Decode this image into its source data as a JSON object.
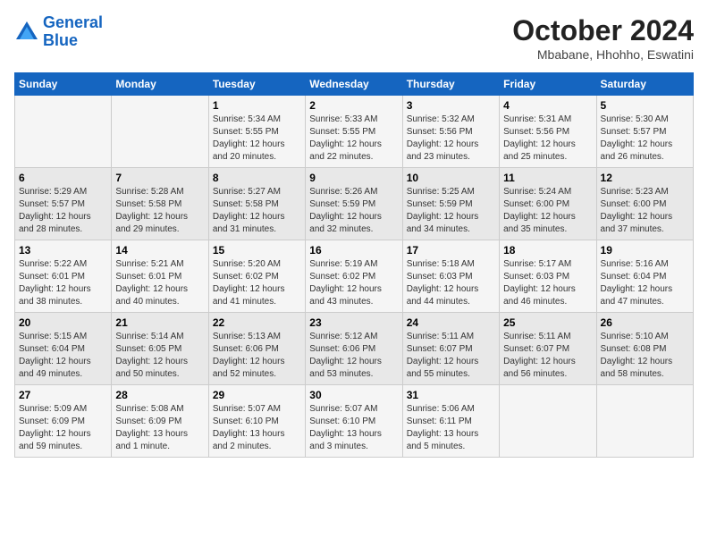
{
  "header": {
    "logo_line1": "General",
    "logo_line2": "Blue",
    "month_title": "October 2024",
    "subtitle": "Mbabane, Hhohho, Eswatini"
  },
  "weekdays": [
    "Sunday",
    "Monday",
    "Tuesday",
    "Wednesday",
    "Thursday",
    "Friday",
    "Saturday"
  ],
  "weeks": [
    [
      {
        "day": "",
        "content": ""
      },
      {
        "day": "",
        "content": ""
      },
      {
        "day": "1",
        "content": "Sunrise: 5:34 AM\nSunset: 5:55 PM\nDaylight: 12 hours\nand 20 minutes."
      },
      {
        "day": "2",
        "content": "Sunrise: 5:33 AM\nSunset: 5:55 PM\nDaylight: 12 hours\nand 22 minutes."
      },
      {
        "day": "3",
        "content": "Sunrise: 5:32 AM\nSunset: 5:56 PM\nDaylight: 12 hours\nand 23 minutes."
      },
      {
        "day": "4",
        "content": "Sunrise: 5:31 AM\nSunset: 5:56 PM\nDaylight: 12 hours\nand 25 minutes."
      },
      {
        "day": "5",
        "content": "Sunrise: 5:30 AM\nSunset: 5:57 PM\nDaylight: 12 hours\nand 26 minutes."
      }
    ],
    [
      {
        "day": "6",
        "content": "Sunrise: 5:29 AM\nSunset: 5:57 PM\nDaylight: 12 hours\nand 28 minutes."
      },
      {
        "day": "7",
        "content": "Sunrise: 5:28 AM\nSunset: 5:58 PM\nDaylight: 12 hours\nand 29 minutes."
      },
      {
        "day": "8",
        "content": "Sunrise: 5:27 AM\nSunset: 5:58 PM\nDaylight: 12 hours\nand 31 minutes."
      },
      {
        "day": "9",
        "content": "Sunrise: 5:26 AM\nSunset: 5:59 PM\nDaylight: 12 hours\nand 32 minutes."
      },
      {
        "day": "10",
        "content": "Sunrise: 5:25 AM\nSunset: 5:59 PM\nDaylight: 12 hours\nand 34 minutes."
      },
      {
        "day": "11",
        "content": "Sunrise: 5:24 AM\nSunset: 6:00 PM\nDaylight: 12 hours\nand 35 minutes."
      },
      {
        "day": "12",
        "content": "Sunrise: 5:23 AM\nSunset: 6:00 PM\nDaylight: 12 hours\nand 37 minutes."
      }
    ],
    [
      {
        "day": "13",
        "content": "Sunrise: 5:22 AM\nSunset: 6:01 PM\nDaylight: 12 hours\nand 38 minutes."
      },
      {
        "day": "14",
        "content": "Sunrise: 5:21 AM\nSunset: 6:01 PM\nDaylight: 12 hours\nand 40 minutes."
      },
      {
        "day": "15",
        "content": "Sunrise: 5:20 AM\nSunset: 6:02 PM\nDaylight: 12 hours\nand 41 minutes."
      },
      {
        "day": "16",
        "content": "Sunrise: 5:19 AM\nSunset: 6:02 PM\nDaylight: 12 hours\nand 43 minutes."
      },
      {
        "day": "17",
        "content": "Sunrise: 5:18 AM\nSunset: 6:03 PM\nDaylight: 12 hours\nand 44 minutes."
      },
      {
        "day": "18",
        "content": "Sunrise: 5:17 AM\nSunset: 6:03 PM\nDaylight: 12 hours\nand 46 minutes."
      },
      {
        "day": "19",
        "content": "Sunrise: 5:16 AM\nSunset: 6:04 PM\nDaylight: 12 hours\nand 47 minutes."
      }
    ],
    [
      {
        "day": "20",
        "content": "Sunrise: 5:15 AM\nSunset: 6:04 PM\nDaylight: 12 hours\nand 49 minutes."
      },
      {
        "day": "21",
        "content": "Sunrise: 5:14 AM\nSunset: 6:05 PM\nDaylight: 12 hours\nand 50 minutes."
      },
      {
        "day": "22",
        "content": "Sunrise: 5:13 AM\nSunset: 6:06 PM\nDaylight: 12 hours\nand 52 minutes."
      },
      {
        "day": "23",
        "content": "Sunrise: 5:12 AM\nSunset: 6:06 PM\nDaylight: 12 hours\nand 53 minutes."
      },
      {
        "day": "24",
        "content": "Sunrise: 5:11 AM\nSunset: 6:07 PM\nDaylight: 12 hours\nand 55 minutes."
      },
      {
        "day": "25",
        "content": "Sunrise: 5:11 AM\nSunset: 6:07 PM\nDaylight: 12 hours\nand 56 minutes."
      },
      {
        "day": "26",
        "content": "Sunrise: 5:10 AM\nSunset: 6:08 PM\nDaylight: 12 hours\nand 58 minutes."
      }
    ],
    [
      {
        "day": "27",
        "content": "Sunrise: 5:09 AM\nSunset: 6:09 PM\nDaylight: 12 hours\nand 59 minutes."
      },
      {
        "day": "28",
        "content": "Sunrise: 5:08 AM\nSunset: 6:09 PM\nDaylight: 13 hours\nand 1 minute."
      },
      {
        "day": "29",
        "content": "Sunrise: 5:07 AM\nSunset: 6:10 PM\nDaylight: 13 hours\nand 2 minutes."
      },
      {
        "day": "30",
        "content": "Sunrise: 5:07 AM\nSunset: 6:10 PM\nDaylight: 13 hours\nand 3 minutes."
      },
      {
        "day": "31",
        "content": "Sunrise: 5:06 AM\nSunset: 6:11 PM\nDaylight: 13 hours\nand 5 minutes."
      },
      {
        "day": "",
        "content": ""
      },
      {
        "day": "",
        "content": ""
      }
    ]
  ]
}
